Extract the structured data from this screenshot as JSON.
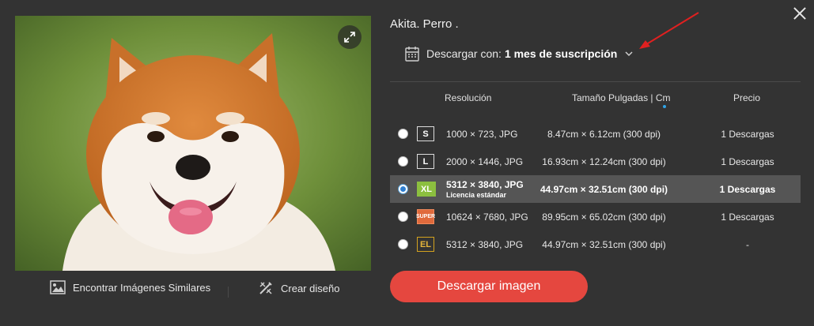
{
  "title": "Akita. Perro .",
  "license": {
    "prefix": "Descargar con:",
    "value": "1 mes de suscripción"
  },
  "preview": {
    "alt": "Akita. Perro ."
  },
  "actions": [
    {
      "label": "Encontrar Imágenes Similares",
      "icon": "image-icon"
    },
    {
      "label": "Crear diseño",
      "icon": "design-tools-icon"
    }
  ],
  "table": {
    "headers": {
      "resolution": "Resolución",
      "size": "Tamaño Pulgadas | Cm",
      "price": "Precio"
    },
    "rows": [
      {
        "badge": "S",
        "resolution": "1000 × 723, JPG",
        "size": "8.47cm × 6.12cm (300 dpi)",
        "price": "1 Descargas",
        "selected": false
      },
      {
        "badge": "L",
        "resolution": "2000 × 1446, JPG",
        "size": "16.93cm × 12.24cm (300 dpi)",
        "price": "1 Descargas",
        "selected": false
      },
      {
        "badge": "XL",
        "resolution": "5312 × 3840, JPG",
        "sublabel": "Licencia estándar",
        "size": "44.97cm × 32.51cm (300 dpi)",
        "price": "1 Descargas",
        "selected": true
      },
      {
        "badge": "SUPER",
        "resolution": "10624 × 7680, JPG",
        "size": "89.95cm × 65.02cm (300 dpi)",
        "price": "1 Descargas",
        "selected": false
      },
      {
        "badge": "EL",
        "resolution": "5312 × 3840, JPG",
        "size": "44.97cm × 32.51cm (300 dpi)",
        "price": "-",
        "selected": false
      }
    ]
  },
  "download_button": "Descargar imagen",
  "colors": {
    "background": "#333333",
    "accent": "#e5473f",
    "selected_row": "#555555",
    "radio_selected": "#2f7fd1",
    "annotation_arrow": "#e02020"
  }
}
